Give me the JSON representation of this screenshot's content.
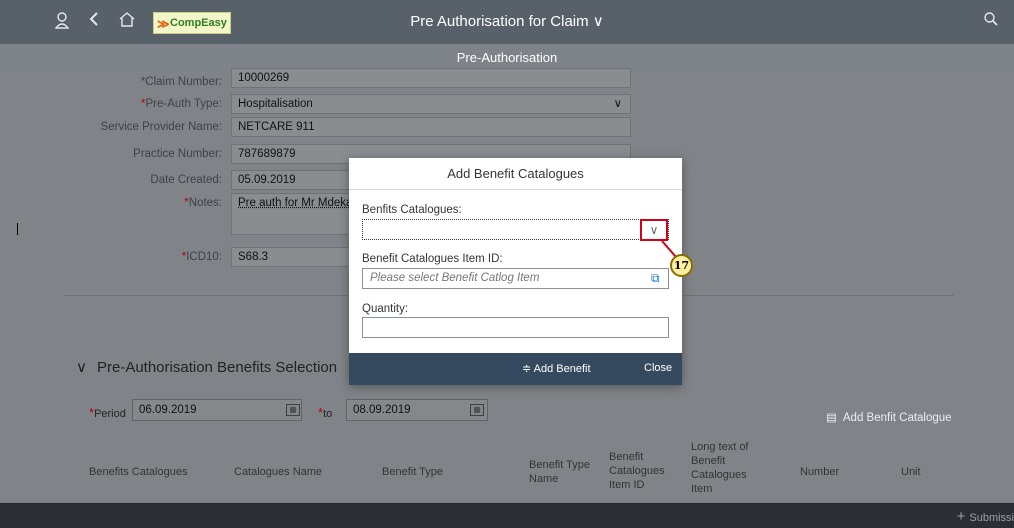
{
  "shell": {
    "title": "Pre Authorisation for Claim ∨",
    "logo_text": "CompEasy",
    "icons": [
      "user-icon",
      "back-icon",
      "home-icon",
      "search-icon"
    ]
  },
  "subheader": {
    "title": "Pre-Authorisation"
  },
  "form": {
    "claim_number": {
      "label": "*Claim Number:",
      "value": "10000269"
    },
    "preauth_type": {
      "label": "Pre-Auth Type:",
      "value": "Hospitalisation"
    },
    "service_provider": {
      "label": "Service Provider Name:",
      "value": "NETCARE 911"
    },
    "practice_number": {
      "label": "Practice Number:",
      "value": "787689879"
    },
    "date_created": {
      "label": "Date Created:",
      "value": "05.09.2019"
    },
    "notes": {
      "label": "Notes:",
      "value": "Pre auth for Mr Mdeka"
    },
    "icd10": {
      "label": "ICD10:",
      "value": "S68.3"
    }
  },
  "benefits_section": {
    "title": "Pre-Authorisation Benefits Selection",
    "period_label": "Period",
    "period_from": "06.09.2019",
    "to_label": "to",
    "period_to": "08.09.2019",
    "add_catalogue": "Add Benfit Catalogue",
    "columns": [
      "Benefits Catalogues",
      "Catalogues Name",
      "Benefit Type",
      "Benefit Type Name",
      "Benefit Catalogues Item ID",
      "Long text of Benefit Catalogues Item",
      "Number",
      "Unit"
    ]
  },
  "footer": {
    "submit_label": "Submissi"
  },
  "dialog": {
    "title": "Add Benefit Catalogues",
    "catalogues_label": "Benfits Catalogues:",
    "catalogues_value": "",
    "item_id_label": "Benefit Catalogues Item ID:",
    "item_id_placeholder": "Please select Benefit Catlog Item",
    "quantity_label": "Quantity:",
    "quantity_value": "",
    "add_button": "Add Benefit",
    "close_button": "Close"
  },
  "annotation": {
    "step": "17",
    "color": "#d0021b"
  }
}
